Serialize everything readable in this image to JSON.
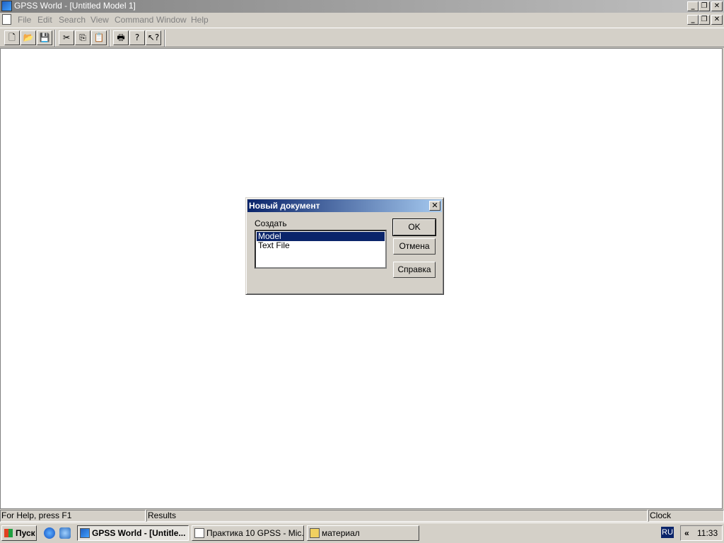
{
  "window": {
    "title": "GPSS World - [Untitled Model 1]",
    "controls": {
      "minimize": "_",
      "restore": "❐",
      "close": "✕"
    }
  },
  "menu": [
    "File",
    "Edit",
    "Search",
    "View",
    "Command",
    "Window",
    "Help"
  ],
  "toolbar": {
    "buttons": [
      {
        "name": "new",
        "icon": "new-document-icon",
        "glyph": "🗋"
      },
      {
        "name": "open",
        "icon": "open-folder-icon",
        "glyph": "📂"
      },
      {
        "name": "save",
        "icon": "floppy-disk-icon",
        "glyph": "💾"
      },
      {
        "name": "cut",
        "icon": "scissors-icon",
        "glyph": "✂"
      },
      {
        "name": "copy",
        "icon": "copy-icon",
        "glyph": "⎘"
      },
      {
        "name": "paste",
        "icon": "clipboard-icon",
        "glyph": "📋"
      },
      {
        "name": "print",
        "icon": "printer-icon",
        "glyph": "🖶"
      },
      {
        "name": "about",
        "icon": "question-icon",
        "glyph": "?"
      },
      {
        "name": "context-help",
        "icon": "pointer-help-icon",
        "glyph": "↖?"
      }
    ]
  },
  "dialog": {
    "title": "Новый документ",
    "close": "✕",
    "label": "Создать",
    "items": [
      "Model",
      "Text File"
    ],
    "selected_index": 0,
    "buttons": {
      "ok": "OK",
      "cancel": "Отмена",
      "help": "Справка"
    }
  },
  "statusbar": {
    "help": "For Help, press F1",
    "results": "Results",
    "clock": "Clock"
  },
  "taskbar": {
    "start": "Пуск",
    "tasks": [
      {
        "label": "GPSS World - [Untitle...",
        "active": true
      },
      {
        "label": "Практика 10 GPSS - Mic...",
        "active": false
      },
      {
        "label": "материал",
        "active": false
      }
    ],
    "language": "RU",
    "chevron": "«",
    "time": "11:33"
  },
  "colors": {
    "selection": "#0a246a",
    "dialog_title_start": "#0a246a",
    "dialog_title_end": "#a6caf0"
  }
}
